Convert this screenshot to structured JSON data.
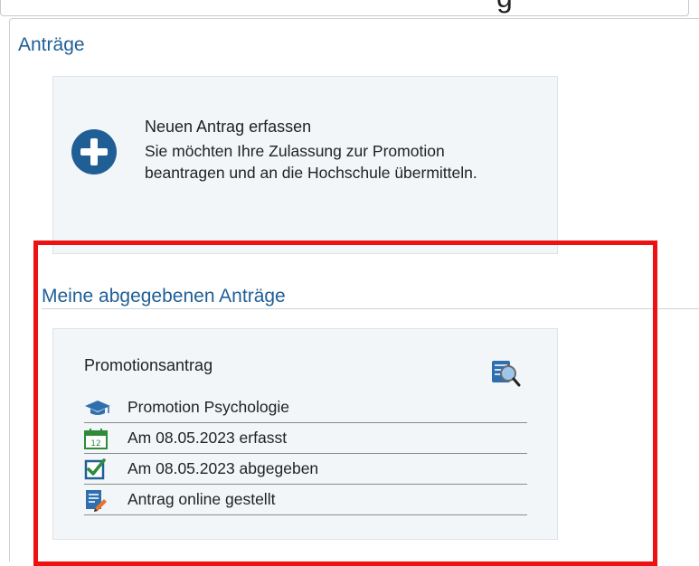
{
  "top_fragment": "g",
  "sections": {
    "antraege_title": "Anträge",
    "meine_title": "Meine abgegebenen Anträge"
  },
  "new_application": {
    "title": "Neuen Antrag erfassen",
    "description": "Sie möchten Ihre Zulassung zur Promotion beantragen und an die Hochschule übermitteln."
  },
  "submitted": {
    "title": "Promotionsantrag",
    "rows": [
      {
        "icon": "graduation-cap-icon",
        "text": "Promotion Psychologie"
      },
      {
        "icon": "calendar-icon",
        "text": "Am 08.05.2023 erfasst"
      },
      {
        "icon": "checkbox-checked-icon",
        "text": "Am 08.05.2023 abgegeben"
      },
      {
        "icon": "document-edit-icon",
        "text": "Antrag online gestellt"
      }
    ]
  },
  "colors": {
    "heading_blue": "#1f5f96",
    "card_bg": "#f3f6f9",
    "highlight_red": "#ee1111",
    "calendar_green": "#2e8b3a"
  }
}
